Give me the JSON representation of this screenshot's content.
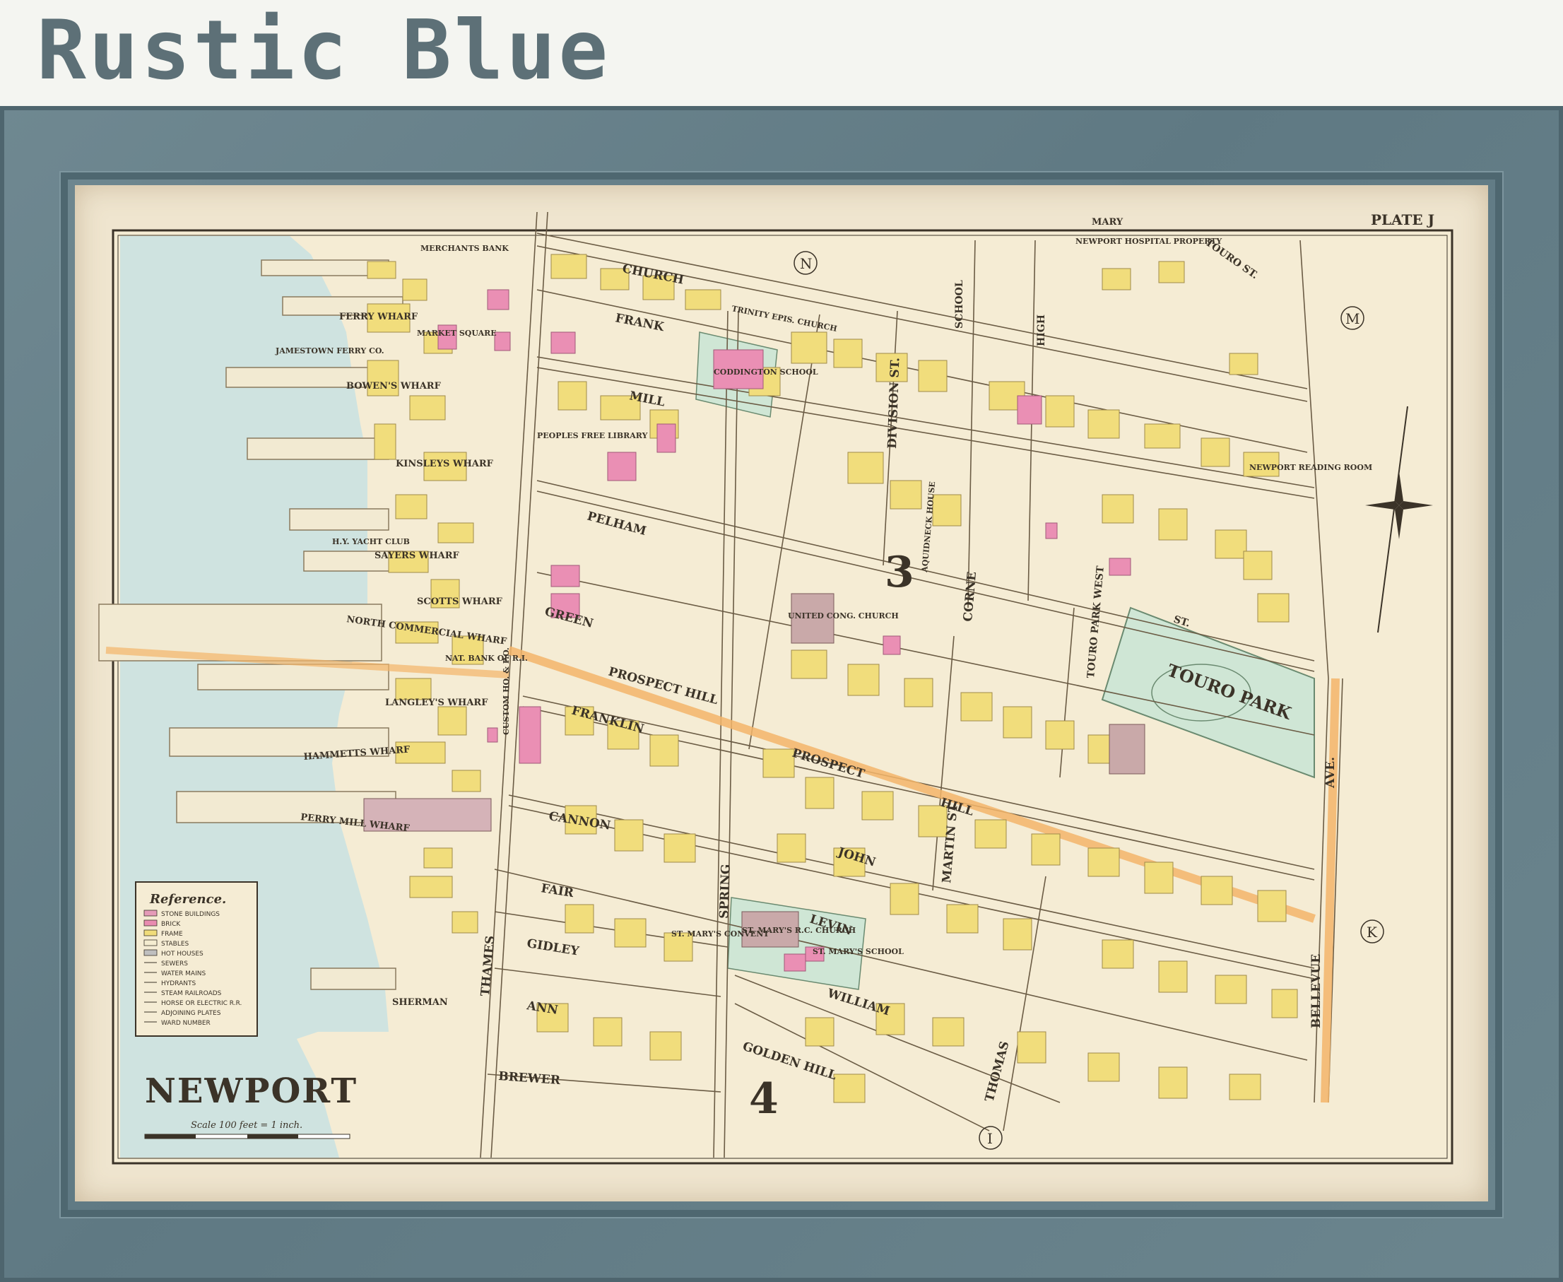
{
  "banner": {
    "title": "Rustic Blue"
  },
  "map": {
    "plate_label": "PLATE J",
    "title": "NEWPORT",
    "scale_text": "Scale 100 feet = 1 inch.",
    "ward_numbers": [
      "3",
      "4"
    ],
    "adjoining_plates": [
      "N",
      "M",
      "K",
      "I"
    ],
    "legend": {
      "title": "Reference.",
      "items": [
        {
          "label": "STONE BUILDINGS",
          "color": "#e59bb8"
        },
        {
          "label": "BRICK",
          "color": "#e98bb0"
        },
        {
          "label": "FRAME",
          "color": "#f0dc7a"
        },
        {
          "label": "STABLES",
          "color": "#f4ecd0"
        },
        {
          "label": "HOT HOUSES",
          "color": "#bfbfbf"
        },
        {
          "label": "SEWERS",
          "color": ""
        },
        {
          "label": "WATER MAINS",
          "color": ""
        },
        {
          "label": "HYDRANTS",
          "color": ""
        },
        {
          "label": "STEAM RAILROADS",
          "color": ""
        },
        {
          "label": "HORSE OR ELECTRIC R.R.",
          "color": ""
        },
        {
          "label": "ADJOINING PLATES",
          "color": ""
        },
        {
          "label": "WARD NUMBER",
          "color": ""
        }
      ]
    },
    "streets": [
      "CHURCH",
      "FRANK",
      "MILL",
      "PELHAM",
      "GREEN",
      "PROSPECT HILL",
      "FRANKLIN",
      "PROSPECT",
      "HILL",
      "CANNON",
      "FAIR",
      "GIDLEY",
      "ANN",
      "BREWER",
      "SHERMAN",
      "THAMES",
      "SPRING",
      "JOHN",
      "LEVIN",
      "WILLIAM",
      "GOLDEN HILL",
      "THOMAS",
      "CORNE",
      "MARTIN ST",
      "DIVISION ST.",
      "SCHOOL",
      "HIGH",
      "MARY",
      "TOURO ST.",
      "BELLEVUE",
      "AVE.",
      "TOURO PARK WEST",
      "ST."
    ],
    "wharves": [
      "FERRY WHARF",
      "BOWEN'S WHARF",
      "KINSLEYS WHARF",
      "SAYERS WHARF",
      "SCOTTS WHARF",
      "NORTH COMMERCIAL WHARF",
      "LANGLEY'S WHARF",
      "HAMMETTS WHARF",
      "PERRY MILL WHARF"
    ],
    "places": [
      "TRINITY EPIS. CHURCH",
      "CODDINGTON SCHOOL",
      "PEOPLES FREE LIBRARY",
      "UNITED CONG. CHURCH",
      "AQUIDNECK HOUSE",
      "TOURO PARK",
      "NEWPORT READING ROOM",
      "ST. MARY'S R.C. CHURCH",
      "ST. MARY'S SCHOOL",
      "ST. MARY'S CONVENT",
      "CUSTOM HO. & P.O.",
      "NEWPORT HOSPITAL PROPERTY",
      "MARKET SQUARE",
      "H.Y. YACHT CLUB",
      "JAMESTOWN FERRY CO.",
      "MERCHANTS BANK",
      "NAT. BANK OF R.I."
    ],
    "colors": {
      "water": "#cfe3e0",
      "paper": "#f5ecd4",
      "frame_building": "#f1dd7c",
      "brick_building": "#ea8fb4",
      "park": "#cfe6d5",
      "main_street_highlight": "#f3b56a",
      "frame": "#5f7983"
    }
  }
}
